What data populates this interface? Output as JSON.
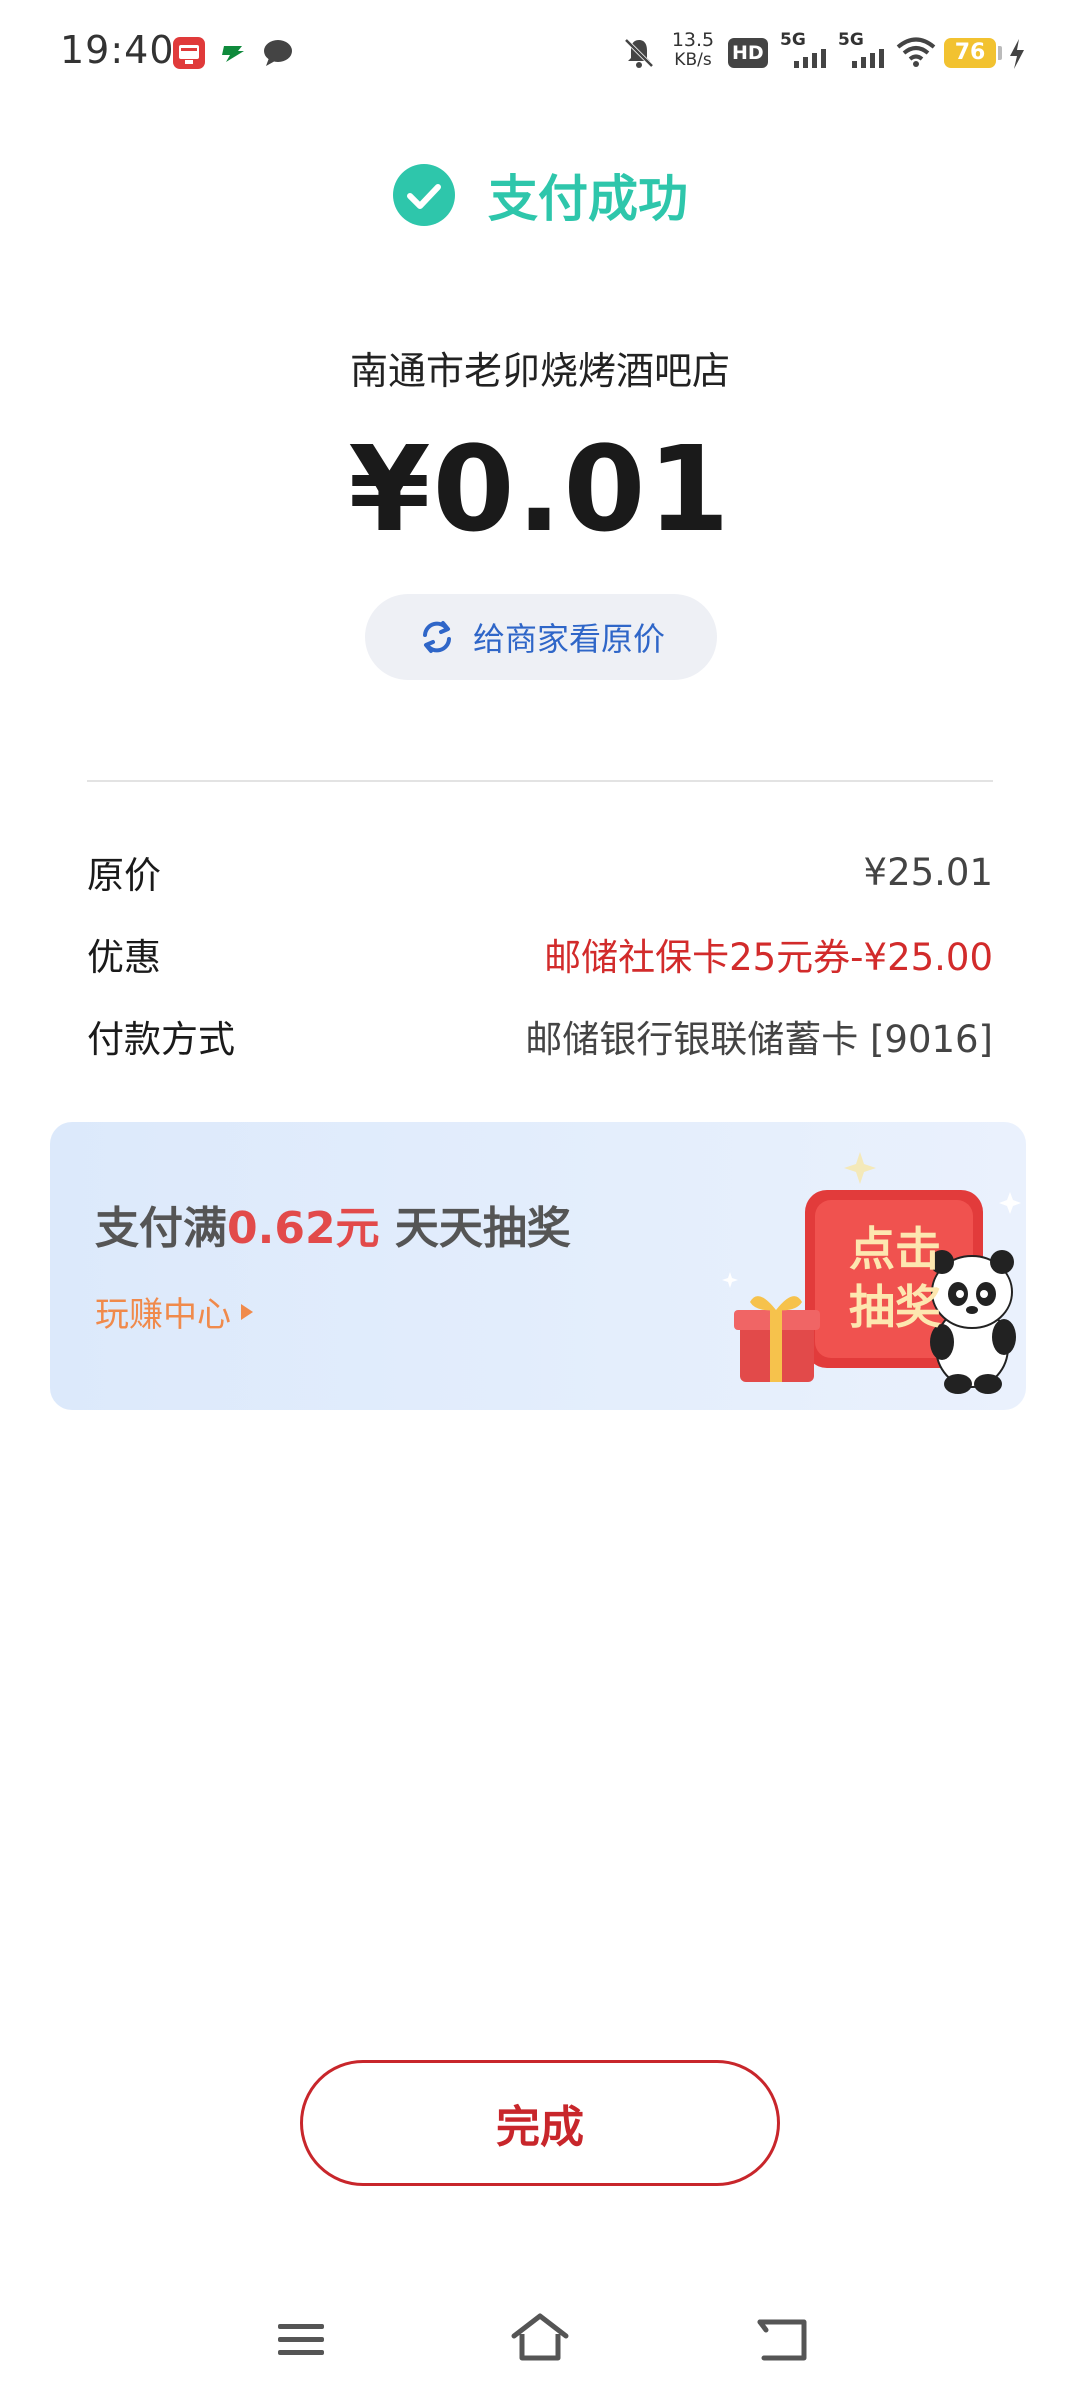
{
  "status_bar": {
    "time": "19:40",
    "net_speed_value": "13.5",
    "net_speed_unit": "KB/s",
    "hd_label": "HD",
    "sim1_label": "5G",
    "sim2_label": "5G",
    "battery": "76",
    "notification_icons": [
      "bank-app-icon",
      "postal-icon",
      "message-bubble-icon"
    ]
  },
  "payment": {
    "status_text": "支付成功",
    "merchant": "南通市老卯烧烤酒吧店",
    "amount": "¥0.01",
    "show_original_label": "给商家看原价"
  },
  "details": [
    {
      "label": "原价",
      "value": "¥25.01",
      "highlight": false
    },
    {
      "label": "优惠",
      "value": "邮储社保卡25元券-¥25.00",
      "highlight": true
    },
    {
      "label": "付款方式",
      "value": "邮储银行银联储蓄卡 [9016]",
      "highlight": false
    }
  ],
  "promo": {
    "title_prefix": "支付满",
    "title_amount": "0.62元",
    "title_suffix": " 天天抽奖",
    "link": "玩赚中心",
    "badge_line1": "点击",
    "badge_line2": "抽奖"
  },
  "done_label": "完成",
  "colors": {
    "success": "#2ec6ab",
    "discount_red": "#d22b2b",
    "brand_red": "#c8262b",
    "link_blue": "#2f66c8",
    "promo_orange": "#f08a4b"
  }
}
